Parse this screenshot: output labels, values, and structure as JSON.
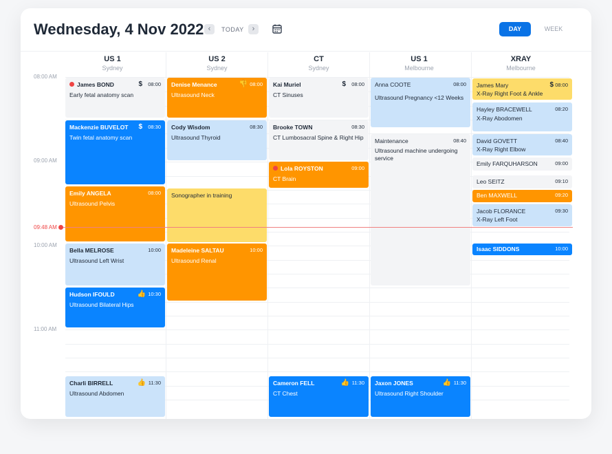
{
  "header": {
    "date": "Wednesday, 4 Nov 2022",
    "prev": "‹",
    "next": "›",
    "today": "TODAY",
    "view_day": "DAY",
    "view_week": "WEEK"
  },
  "columns": [
    {
      "name": "US 1",
      "location": "Sydney"
    },
    {
      "name": "US 2",
      "location": "Sydney"
    },
    {
      "name": "CT",
      "location": "Sydney"
    },
    {
      "name": "US 1",
      "location": "Melbourne"
    },
    {
      "name": "XRAY",
      "location": "Melbourne"
    }
  ],
  "time_labels": [
    "08:00 AM",
    "09:00 AM",
    "10:00 AM",
    "11:00 AM"
  ],
  "now": "09:48 AM",
  "events": {
    "c1": [
      {
        "name": "James BOND",
        "desc": "Early fetal anatomy scan",
        "time": "08:00",
        "icon": "$"
      },
      {
        "name": "Mackenzie BUVELOT",
        "desc": "Twin fetal anatomy scan",
        "time": "08:30",
        "icon": "$"
      },
      {
        "name": "Emily ANGELA",
        "desc": "Ultrasound Pelvis",
        "time": "08:00"
      },
      {
        "name": "Bella MELROSE",
        "desc": "Ultrasound Left Wrist",
        "time": "10:00"
      },
      {
        "name": "Hudson IFOULD",
        "desc": "Ultrasound Bilateral Hips",
        "time": "10:30",
        "icon": "👍"
      },
      {
        "name": "Charli BIRRELL",
        "desc": "Ultrasound Abdomen",
        "time": "11:30",
        "icon": "👍"
      }
    ],
    "c2": [
      {
        "name": "Denise Menance",
        "desc": "Ultrasound Neck",
        "time": "08:00",
        "icon": "👎"
      },
      {
        "name": "Cody Wisdom",
        "desc": "Ultrasound Thyroid",
        "time": "08:30"
      },
      {
        "name": "Sonographer in training"
      },
      {
        "name": "Madeleine SALTAU",
        "desc": "Ultrasound Renal",
        "time": "10:00"
      }
    ],
    "c3": [
      {
        "name": "Kai Muriel",
        "desc": "CT Sinuses",
        "time": "08:00",
        "icon": "$"
      },
      {
        "name": "Brooke TOWN",
        "desc": "CT Lumbosacral Spine & Right Hip",
        "time": "08:30"
      },
      {
        "name": "Lola ROYSTON",
        "desc": "CT Brain",
        "time": "09:00"
      },
      {
        "name": "Cameron FELL",
        "desc": "CT Chest",
        "time": "11:30",
        "icon": "👍"
      }
    ],
    "c4": [
      {
        "name": "Anna COOTE",
        "desc": "Ultrasound Pregnancy <12 Weeks",
        "time": "08:00"
      },
      {
        "name": "Maintenance",
        "desc": "Ultrasound machine undergoing service",
        "time": "08:40"
      },
      {
        "name": "Jaxon JONES",
        "desc": "Ultrasound Right Shoulder",
        "time": "11:30",
        "icon": "👍"
      }
    ],
    "c5": [
      {
        "name": "James Mary",
        "desc": "X-Ray Right Foot & Ankle",
        "time": "08:00",
        "icon": "$"
      },
      {
        "name": "Hayley BRACEWELL",
        "desc": "X-Ray Abodomen",
        "time": "08:20"
      },
      {
        "name": "David GOVETT",
        "desc": "X-Ray Right Elbow",
        "time": "08:40"
      },
      {
        "name": "Emily FARQUHARSON",
        "time": "09:00"
      },
      {
        "name": "Leo SEITZ",
        "time": "09:10"
      },
      {
        "name": "Ben MAXWELL",
        "time": "09:20"
      },
      {
        "name": "Jacob FLORANCE",
        "desc": "X-Ray Left Foot",
        "time": "09:30"
      },
      {
        "name": "Isaac SIDDONS",
        "time": "10:00"
      }
    ]
  },
  "colors": {
    "primary": "#0a84ff",
    "orange": "#ff9500",
    "yellow": "#fddc6a",
    "light_blue": "#cbe3fa",
    "now": "#ef4444"
  }
}
